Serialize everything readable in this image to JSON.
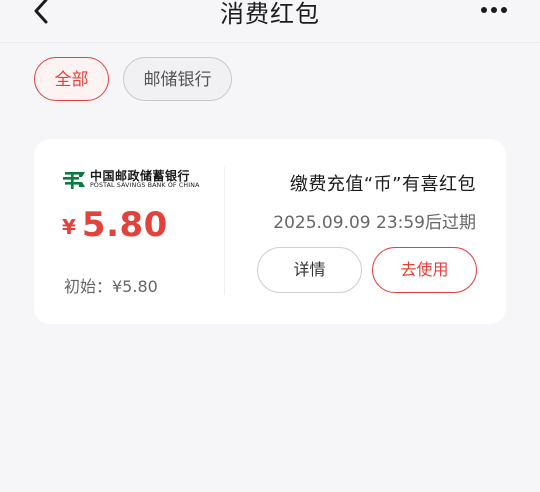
{
  "header": {
    "title": "消费红包",
    "back_icon": "chevron-left-icon",
    "more_icon": "more-dots-icon"
  },
  "filters": [
    {
      "label": "全部",
      "selected": true
    },
    {
      "label": "邮储银行",
      "selected": false
    }
  ],
  "coupon": {
    "bank_name_cn": "中国邮政储蓄银行",
    "bank_name_en": "POSTAL SAVINGS BANK OF CHINA",
    "currency": "¥",
    "amount": "5.80",
    "initial_label": "初始：¥5.80",
    "title": "缴费充值“币”有喜红包",
    "expiry": "2025.09.09 23:59后过期",
    "detail_button": "详情",
    "use_button": "去使用"
  },
  "colors": {
    "accent": "#e3423c",
    "bank_green": "#0a7a3e",
    "background": "#f6f6f8"
  }
}
